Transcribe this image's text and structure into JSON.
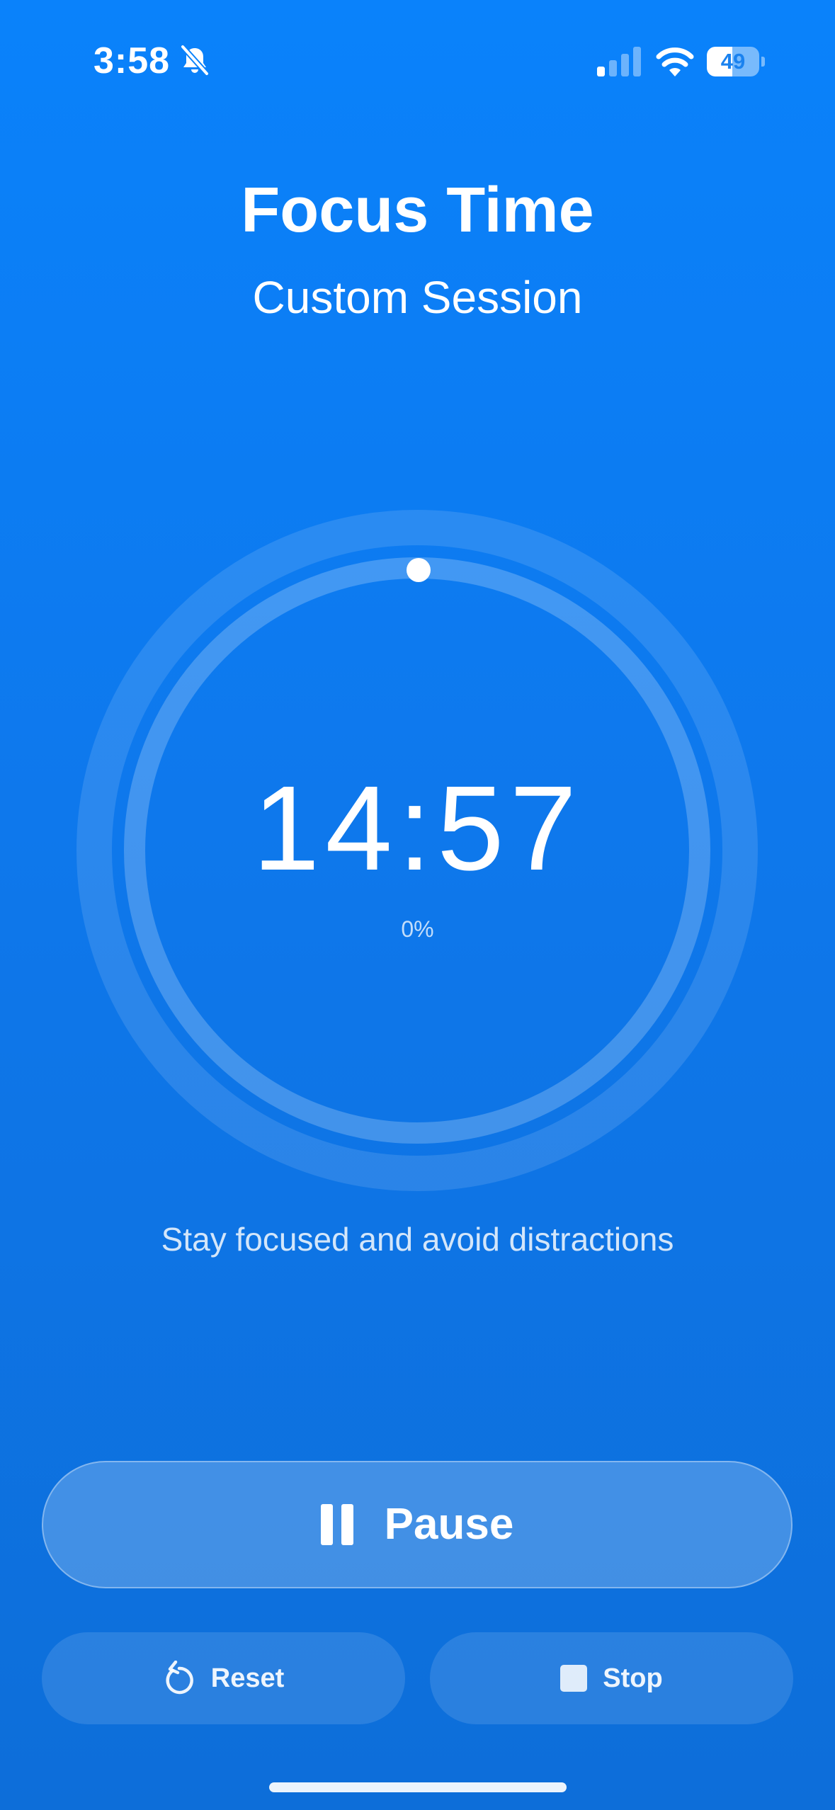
{
  "status_bar": {
    "time": "3:58",
    "silent_icon": "bell-slash-icon",
    "signal_icon": "cellular-signal-icon",
    "signal_bars_active": 1,
    "signal_bars_total": 4,
    "wifi_icon": "wifi-icon",
    "battery_level": "49",
    "battery_fraction": 0.49
  },
  "header": {
    "title": "Focus Time",
    "subtitle": "Custom Session"
  },
  "timer": {
    "time_remaining": "14:57",
    "progress_text": "0%",
    "progress_fraction": 0.0,
    "hint": "Stay focused and avoid distractions"
  },
  "controls": {
    "primary": {
      "label": "Pause",
      "icon": "pause-icon"
    },
    "reset": {
      "label": "Reset",
      "icon": "reset-arrow-icon"
    },
    "stop": {
      "label": "Stop",
      "icon": "stop-square-icon"
    }
  },
  "colors": {
    "background_top": "#0a82fb",
    "background_bottom": "#0d6ed9",
    "text": "#ffffff"
  }
}
